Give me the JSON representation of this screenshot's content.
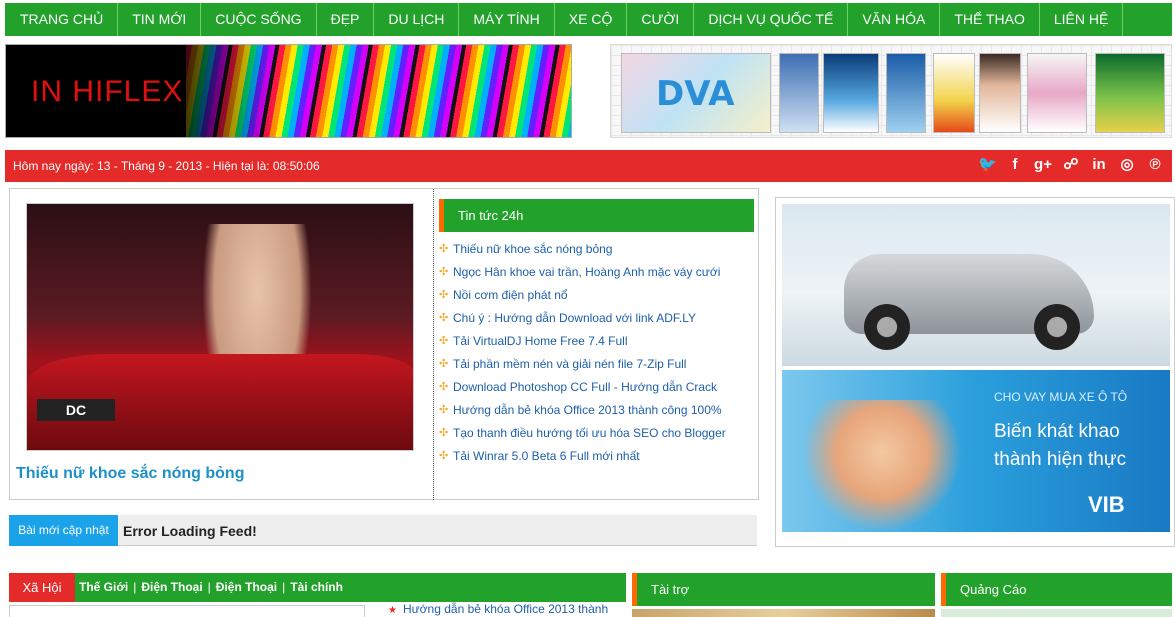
{
  "nav": {
    "items": [
      "TRANG CHỦ",
      "TIN MỚI",
      "CUỘC SỐNG",
      "ĐẸP",
      "DU LỊCH",
      "MÁY TÍNH",
      "XE CỘ",
      "CƯỜI",
      "DỊCH VỤ QUỐC TẾ",
      "VĂN HÓA",
      "THỂ THAO",
      "LIÊN HỆ"
    ]
  },
  "header": {
    "banner_left_text": "IN HIFLEX",
    "banner_right_text": "DVA"
  },
  "datebar": {
    "date_text": "Hôm nay ngày: 13 - Tháng 9 - 2013 - Hiện tại là:  08:50:06",
    "social_icons": [
      "twitter-icon",
      "facebook-icon",
      "google-plus-icon",
      "rss-icon",
      "linkedin-icon",
      "dribbble-icon",
      "pinterest-icon"
    ]
  },
  "featured": {
    "title": "Thiếu nữ khoe sắc nóng bỏng",
    "plate_text": "DC"
  },
  "news24": {
    "heading": "Tin tức 24h",
    "items": [
      "Thiếu nữ khoe sắc nóng bỏng",
      "Ngọc Hân khoe vai trần, Hoàng Anh mặc váy cưới",
      "Nồi cơm điện phát nổ",
      "Chú ý : Hướng dẫn Download với link ADF.LY",
      "Tải VirtualDJ Home Free 7.4 Full",
      "Tải phần mềm nén và giải nén file 7-Zip Full",
      "Download Photoshop CC Full - Hướng dẫn Crack",
      "Hướng dẫn bẻ khóa Office 2013 thành công 100%",
      "Tạo thanh điều hướng tối ưu hóa SEO cho Blogger",
      "Tải Winrar 5.0 Beta 6 Full mới nhất"
    ]
  },
  "latest": {
    "label": "Bài mới cập nhật",
    "feed_text": "Error Loading Feed!"
  },
  "ad": {
    "vib_small": "CHO VAY MUA XE Ô TÔ",
    "vib_big": "Biến khát khao thành hiện thực",
    "vib_brand": "VIB"
  },
  "section": {
    "tag": "Xã Hội",
    "links": [
      "Thế Giới",
      "Điện Thoại",
      "Điện Thoại",
      "Tài chính"
    ],
    "separator": "|",
    "first_item": "Hướng dẫn bẻ khóa Office 2013 thành"
  },
  "sidebar": {
    "sponsor_heading": "Tài trợ",
    "ads_heading": "Quảng Cáo"
  },
  "colors": {
    "nav_green": "#22a22b",
    "date_red": "#e52a2a",
    "accent_orange": "#ff6a00",
    "link_blue": "#1e5fa8",
    "latest_blue": "#1aa3e8"
  }
}
